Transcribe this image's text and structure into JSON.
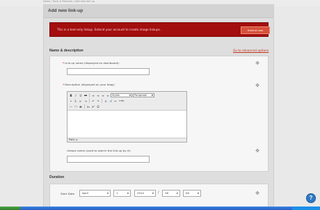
{
  "breadcrumb": "Home  /  Tools & Features  /  Add new link-up",
  "page": {
    "title": "Add new link-up"
  },
  "alert": {
    "message": "This is a text-only linkup. Extend your account to create image linkups.",
    "button_label": "Extend now"
  },
  "name_section": {
    "title": "Name & description",
    "advanced_link": "Go to advanced options"
  },
  "fields": {
    "linkup_name": {
      "label": "Link-up name (displayed on dashboard):",
      "value": ""
    },
    "description": {
      "label": "Description (displayed on your blog):"
    },
    "unique_name": {
      "label": "Unique name (used to search the link-up by it):",
      "value": ""
    }
  },
  "editor": {
    "style_select": "Styles",
    "format_select": "Paragraph",
    "status_path": "Path: p",
    "buttons_row1": [
      "B",
      "I",
      "U",
      "ABC",
      "≡",
      "≡",
      "≡",
      "≡"
    ],
    "buttons_row2": [
      "•",
      "1.",
      "⇤",
      "⇥",
      "↶",
      "↷",
      "⚓",
      "🔗",
      "✂",
      "HTML"
    ],
    "buttons_row3": [
      "—",
      "□",
      "▦",
      "x₂",
      "x²",
      "Ω"
    ]
  },
  "duration": {
    "title": "Duration",
    "start_label": "Start Date",
    "month": "April",
    "day": "1",
    "year": "2014",
    "hour": "26",
    "minute": "00"
  },
  "help": {
    "label": "?"
  }
}
